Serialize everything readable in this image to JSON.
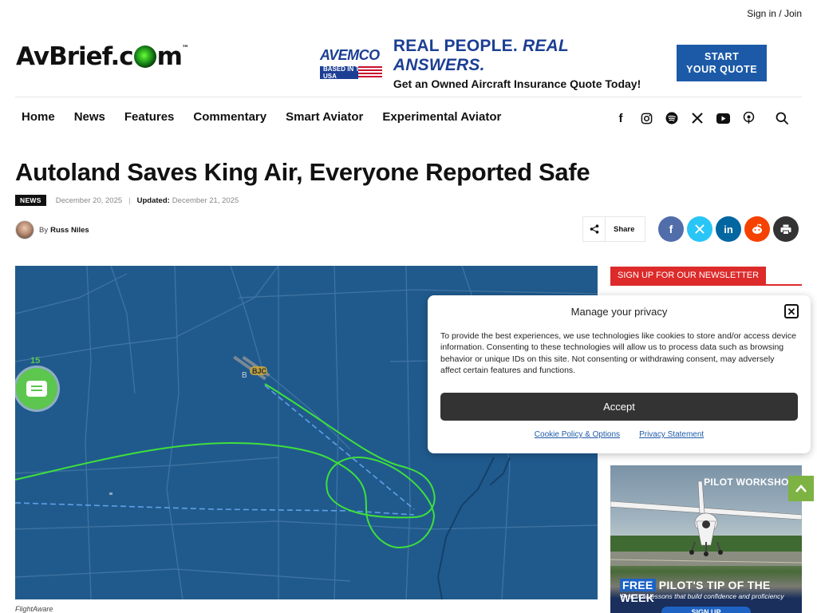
{
  "header": {
    "signin": "Sign in / Join",
    "logo": {
      "left": "AvBrief.c",
      "right": "m",
      "tm": "™"
    },
    "ad": {
      "brand": "AVEMCO",
      "badge": "BASED IN THE USA",
      "headline_a": "REAL PEOPLE.",
      "headline_b": "REAL ANSWERS.",
      "subline": "Get an Owned Aircraft Insurance Quote Today!",
      "button_l1": "START",
      "button_l2": "YOUR QUOTE"
    }
  },
  "nav": {
    "items": [
      "Home",
      "News",
      "Features",
      "Commentary",
      "Smart Aviator",
      "Experimental Aviator"
    ],
    "social": [
      "facebook-icon",
      "instagram-icon",
      "spotify-icon",
      "x-icon",
      "youtube-icon",
      "podcast-icon",
      "search-icon"
    ]
  },
  "article": {
    "title": "Autoland Saves King Air, Everyone Reported Safe",
    "category": "NEWS",
    "date": "December 20, 2025",
    "updated_label": "Updated:",
    "updated_date": "December 21, 2025",
    "by": "By",
    "author": "Russ Niles",
    "share_label": "Share",
    "caption": "FlightAware",
    "map_labels": {
      "airport": "BJC",
      "airport_prefix": "B"
    }
  },
  "chat": {
    "count": "15"
  },
  "sidebar": {
    "newsletter": "SIGN UP FOR OUR NEWSLETTER",
    "ad": {
      "brand": "PILOT WORKSHOP",
      "title_free": "FREE",
      "title_rest": "PILOT'S TIP OF THE WEEK",
      "subtitle": "Practical lessons that build confidence and proficiency",
      "button": "SIGN UP"
    }
  },
  "privacy": {
    "title": "Manage your privacy",
    "text": "To provide the best experiences, we use technologies like cookies to store and/or access device information. Consenting to these technologies will allow us to process data such as browsing behavior or unique IDs on this site. Not consenting or withdrawing consent, may adversely affect certain features and functions.",
    "accept": "Accept",
    "link_cookie": "Cookie Policy & Options",
    "link_privacy": "Privacy Statement"
  },
  "colors": {
    "map_bg": "#205a8d",
    "track": "#3ee03b",
    "newsletter_red": "#dd2a2a",
    "accent_green": "#5cc64f",
    "facebook": "#516eab",
    "twitter": "#29c5f6",
    "linkedin": "#0266a0",
    "reddit": "#f54200",
    "print": "#333333"
  }
}
